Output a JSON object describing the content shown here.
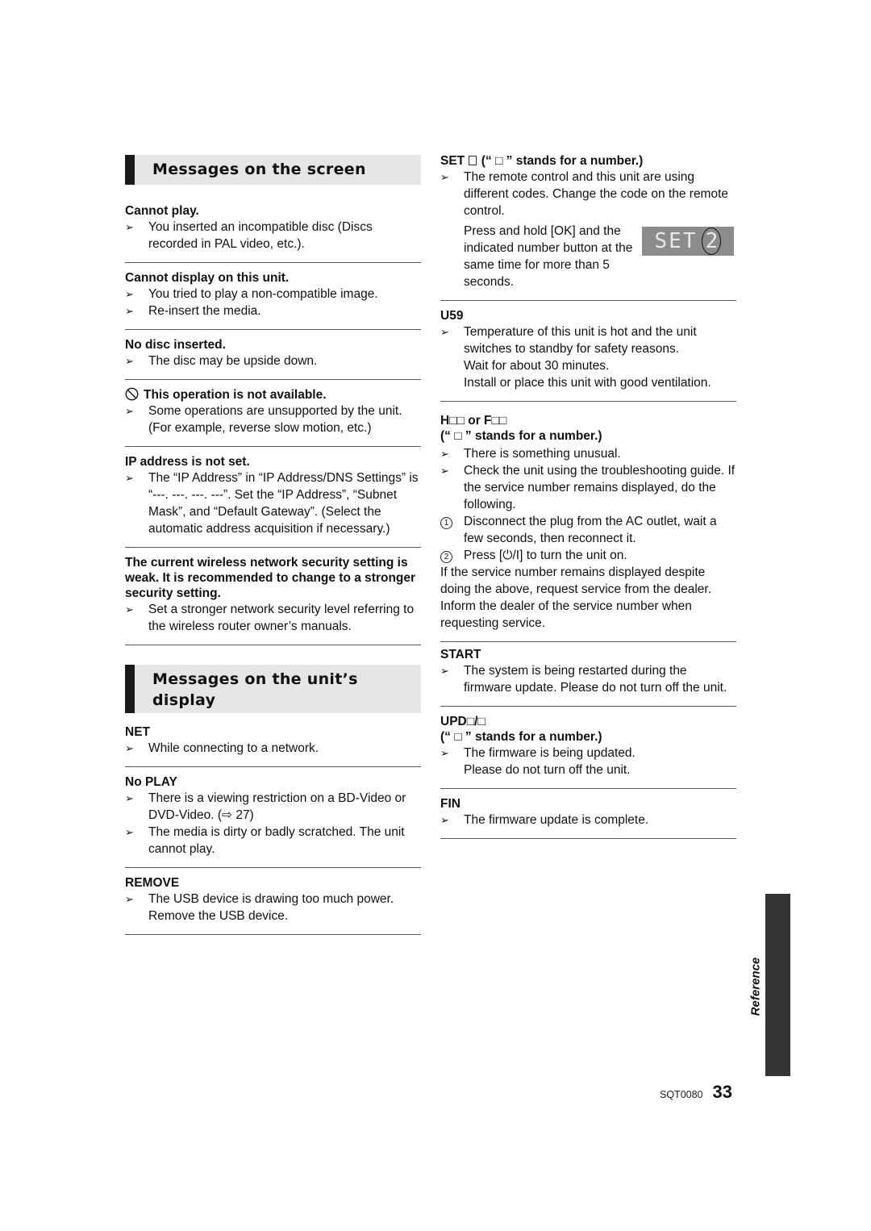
{
  "left_column": {
    "section1": {
      "title": "Messages on the screen",
      "entries": [
        {
          "title": "Cannot play.",
          "bullets": [
            "You inserted an incompatible disc (Discs recorded in PAL video, etc.)."
          ]
        },
        {
          "title": "Cannot display on this unit.",
          "bullets": [
            "You tried to play a non-compatible image.",
            "Re-insert the media."
          ]
        },
        {
          "title": "No disc inserted.",
          "bullets": [
            "The disc may be upside down."
          ]
        },
        {
          "title": "This operation is not available.",
          "icon": "prohibited-icon",
          "bullets": [
            "Some operations are unsupported by the unit. (For example, reverse slow motion, etc.)"
          ]
        },
        {
          "title": "IP address is not set.",
          "bullets": [
            "The “IP Address” in “IP Address/DNS Settings” is “---. ---. ---. ---”. Set the “IP Address”, “Subnet Mask”, and “Default Gateway”. (Select the automatic address acquisition if necessary.)"
          ]
        },
        {
          "title": "The current wireless network security setting is weak. It is recommended to change to a stronger security setting.",
          "bullets": [
            "Set a stronger network security level referring to the wireless router owner’s manuals."
          ]
        }
      ]
    },
    "section2": {
      "title": "Messages on the unit’s display",
      "entries": [
        {
          "title": "NET",
          "bullets": [
            "While connecting to a network."
          ]
        },
        {
          "title": "No PLAY",
          "bullets": [
            "There is a viewing restriction on a BD-Video or DVD-Video. (⇨ 27)",
            "The media is dirty or badly scratched. The unit cannot play."
          ]
        },
        {
          "title": "REMOVE",
          "bullets": [
            "The USB device is drawing too much power. Remove the USB device."
          ]
        }
      ]
    }
  },
  "right_column": {
    "set": {
      "title_prefix": "SET",
      "title_suffix": "(“ □ ” stands for a number.)",
      "bullet": "The remote control and this unit are using different codes. Change the code on the remote control.",
      "instruction": "Press and hold [OK] and the indicated number button at the same time for more than 5 seconds.",
      "lcd_text": "SET",
      "lcd_number": "2"
    },
    "u59": {
      "title": "U59",
      "bullet": "Temperature of this unit is hot and the unit switches to standby for safety reasons.",
      "lines": [
        "Wait for about 30 minutes.",
        "Install or place this unit with good ventilation."
      ]
    },
    "hf": {
      "title": "H□□ or F□□",
      "subtitle": "(“ □ ” stands for a number.)",
      "bullets": [
        "There is something unusual.",
        "Check the unit using the troubleshooting guide. If the service number remains displayed, do the following."
      ],
      "steps": [
        {
          "num": "1",
          "text": "Disconnect the plug from the AC outlet, wait a few seconds, then reconnect it."
        },
        {
          "num": "2",
          "text": "Press [⏻/I] to turn the unit on."
        }
      ],
      "note": "If the service number remains displayed despite doing the above, request service from the dealer. Inform the dealer of the service number when requesting service."
    },
    "start": {
      "title": "START",
      "bullet": "The system is being restarted during the firmware update. Please do not turn off the unit."
    },
    "upd": {
      "title": "UPD□/□",
      "subtitle": "(“ □ ” stands for a number.)",
      "bullet": "The firmware is being updated.",
      "line": "Please do not turn off the unit."
    },
    "fin": {
      "title": "FIN",
      "bullet": "The firmware update is complete."
    }
  },
  "side_tab": {
    "label": "Reference"
  },
  "footer": {
    "code": "SQT0080",
    "page": "33"
  },
  "bullet_marker": "➢"
}
